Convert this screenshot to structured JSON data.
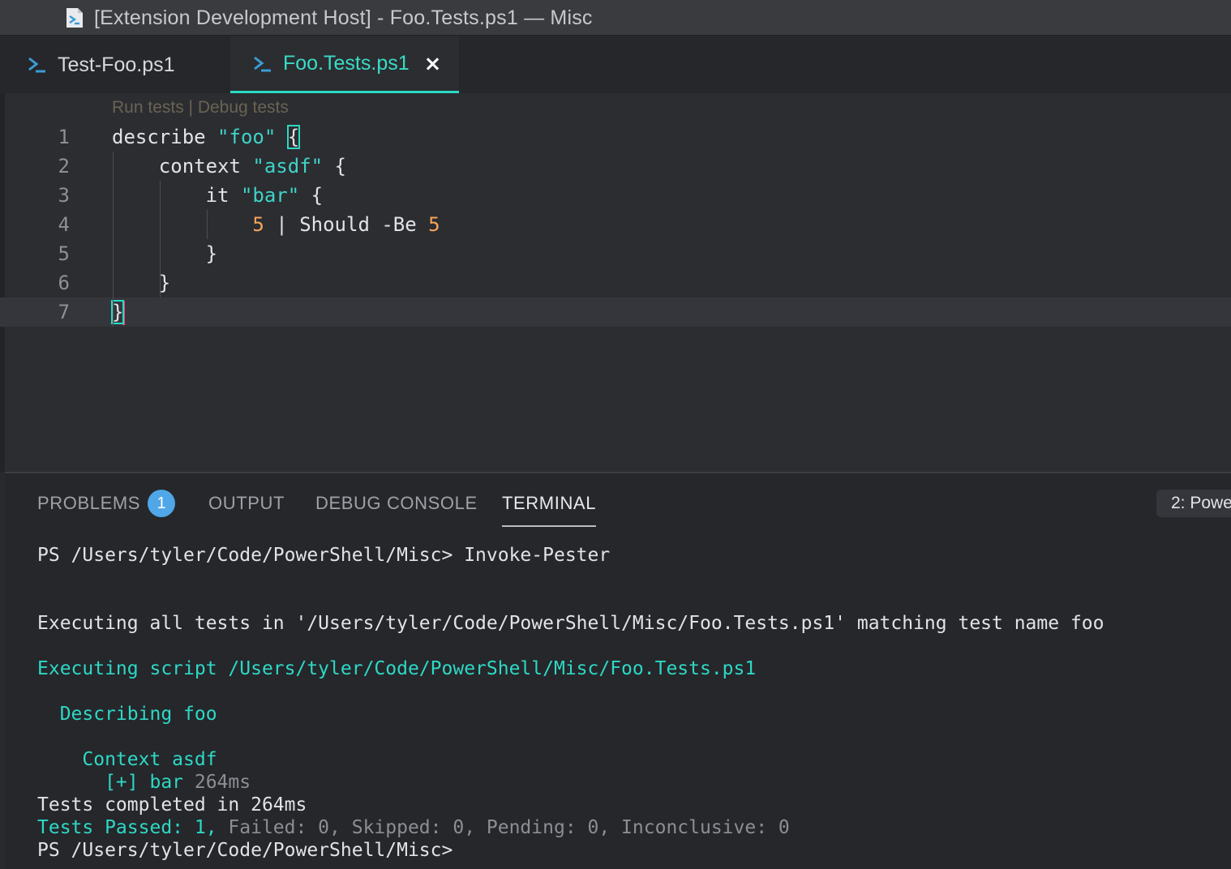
{
  "window": {
    "title": "[Extension Development Host] - Foo.Tests.ps1 — Misc",
    "title_icon": "powershell-file-icon"
  },
  "tabs": [
    {
      "label": "Test-Foo.ps1",
      "icon": "powershell-prompt-icon",
      "active": false
    },
    {
      "label": "Foo.Tests.ps1",
      "icon": "powershell-prompt-icon",
      "active": true,
      "close": "×"
    }
  ],
  "editor": {
    "codelens": "Run tests | Debug tests",
    "current_line": 7,
    "lines": [
      {
        "num": "1",
        "parts": [
          {
            "t": "describe ",
            "c": "kw"
          },
          {
            "t": "\"foo\"",
            "c": "str"
          },
          {
            "t": " ",
            "c": "kw"
          },
          {
            "t": "{",
            "c": "brace"
          }
        ]
      },
      {
        "num": "2",
        "parts": [
          {
            "t": "    context ",
            "c": "kw"
          },
          {
            "t": "\"asdf\"",
            "c": "str"
          },
          {
            "t": " {",
            "c": "kw"
          }
        ]
      },
      {
        "num": "3",
        "parts": [
          {
            "t": "        it ",
            "c": "kw"
          },
          {
            "t": "\"bar\"",
            "c": "str"
          },
          {
            "t": " {",
            "c": "kw"
          }
        ]
      },
      {
        "num": "4",
        "parts": [
          {
            "t": "            ",
            "c": "kw"
          },
          {
            "t": "5",
            "c": "num"
          },
          {
            "t": " | Should -Be ",
            "c": "kw"
          },
          {
            "t": "5",
            "c": "num"
          }
        ]
      },
      {
        "num": "5",
        "parts": [
          {
            "t": "        }",
            "c": "kw"
          }
        ]
      },
      {
        "num": "6",
        "parts": [
          {
            "t": "    }",
            "c": "kw"
          }
        ]
      },
      {
        "num": "7",
        "parts": [
          {
            "t": "}",
            "c": "brace"
          },
          {
            "t": "",
            "c": "cursor"
          }
        ]
      }
    ]
  },
  "panel": {
    "tabs": {
      "problems": "PROBLEMS",
      "problems_count": "1",
      "output": "OUTPUT",
      "debug_console": "DEBUG CONSOLE",
      "terminal": "TERMINAL"
    },
    "terminal_selector": "2: Powe"
  },
  "terminal": {
    "prompt_cmd": "PS /Users/tyler/Code/PowerShell/Misc> Invoke-Pester",
    "executing_all": "Executing all tests in '/Users/tyler/Code/PowerShell/Misc/Foo.Tests.ps1' matching test name foo",
    "executing_script": "Executing script /Users/tyler/Code/PowerShell/Misc/Foo.Tests.ps1",
    "describing": "  Describing foo",
    "context": "    Context asdf",
    "test_result": "      [+] bar",
    "test_time": " 264ms",
    "completed": "Tests completed in 264ms",
    "passed": "Tests Passed: 1,",
    "summary_rest": " Failed: 0, Skipped: 0, Pending: 0, Inconclusive: 0",
    "final_prompt": "PS /Users/tyler/Code/PowerShell/Misc>"
  },
  "colors": {
    "accent": "#2ad9c3",
    "string": "#3fd3c7",
    "number": "#f5a65b",
    "cursor": "#ff3c78",
    "badge": "#4fa7e8"
  }
}
